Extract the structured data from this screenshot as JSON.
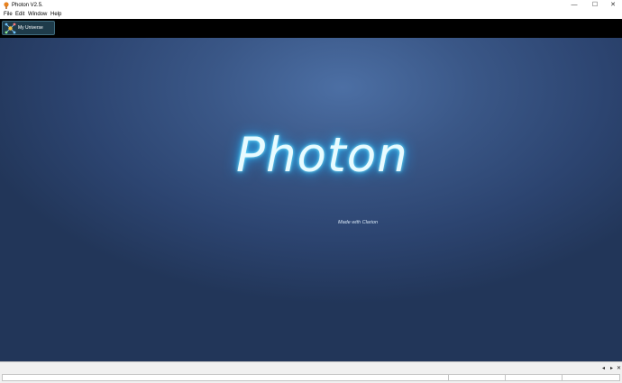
{
  "window": {
    "title": "Photon V2.5."
  },
  "window_controls": {
    "minimize": "—",
    "maximize": "☐",
    "close": "✕"
  },
  "menu": {
    "items": [
      "File",
      "Edit",
      "Window",
      "Help"
    ]
  },
  "toolbar": {
    "my_universe_label": "My Universe"
  },
  "splash": {
    "logo": "Photon",
    "tagline": "Made with Clarion"
  },
  "status": {
    "prev": "◂",
    "next": "▸",
    "close": "✕"
  },
  "colors": {
    "toolbar_bg": "#000000",
    "canvas_center": "#4c6fa4",
    "canvas_edge": "#223659",
    "glow": "#37c8ff"
  }
}
